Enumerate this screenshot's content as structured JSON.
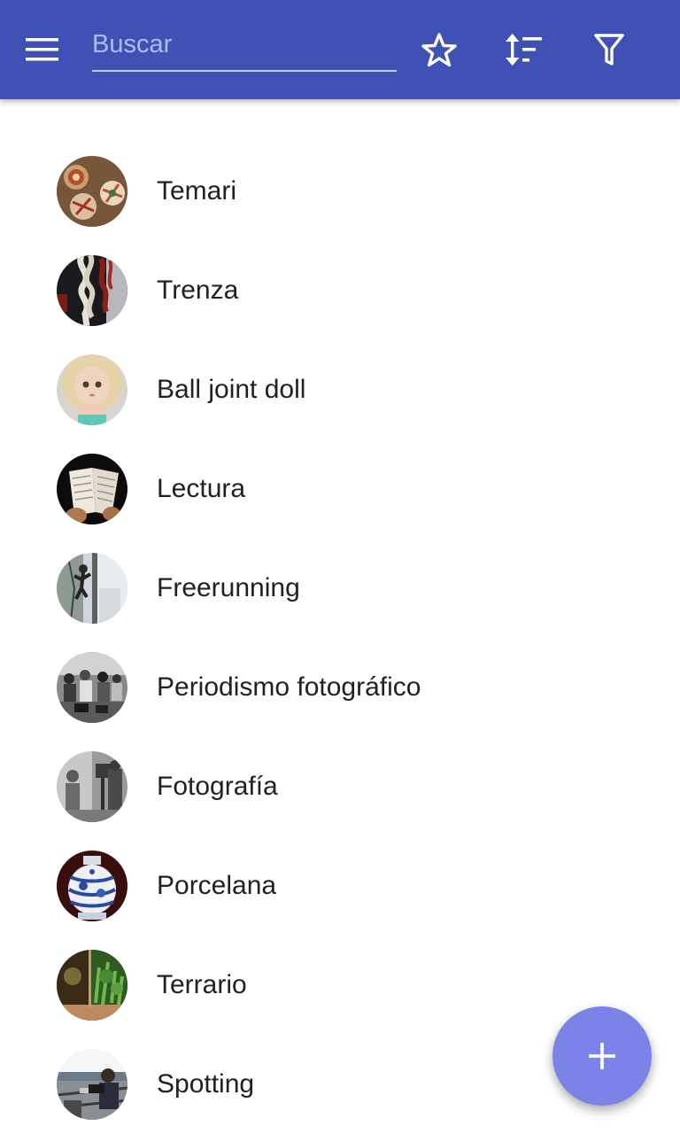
{
  "toolbar": {
    "background": "#3f51b5",
    "menu_icon": "menu-icon",
    "search_placeholder": "Buscar",
    "search_value": "",
    "actions": [
      "star-outline-icon",
      "sort-icon",
      "filter-icon"
    ]
  },
  "list": {
    "items": [
      {
        "label": "Temari",
        "avatar": "temari-photo"
      },
      {
        "label": "Trenza",
        "avatar": "braid-photo"
      },
      {
        "label": "Ball joint doll",
        "avatar": "doll-photo"
      },
      {
        "label": "Lectura",
        "avatar": "book-photo"
      },
      {
        "label": "Freerunning",
        "avatar": "freerunning-photo"
      },
      {
        "label": "Periodismo fotográfico",
        "avatar": "photojournalism-photo"
      },
      {
        "label": "Fotografía",
        "avatar": "photography-photo"
      },
      {
        "label": "Porcelana",
        "avatar": "porcelain-vase-photo"
      },
      {
        "label": "Terrario",
        "avatar": "terrarium-photo"
      },
      {
        "label": "Spotting",
        "avatar": "spotting-photo"
      }
    ]
  },
  "fab": {
    "icon": "plus-icon",
    "color": "#7b83e8"
  }
}
